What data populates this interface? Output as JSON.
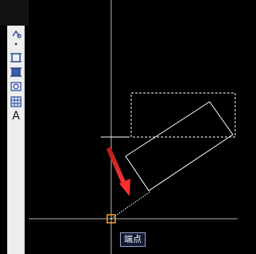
{
  "toolbar": {
    "tools": [
      {
        "icon": "snap-tool-icon"
      },
      {
        "icon": "point-icon"
      },
      {
        "icon": "hatch-icon"
      },
      {
        "icon": "gradient-icon"
      },
      {
        "icon": "region-icon"
      },
      {
        "icon": "table-icon"
      },
      {
        "icon": "text-icon",
        "label": "A"
      }
    ]
  },
  "tooltip": {
    "text": "端点"
  },
  "colors": {
    "canvas_background": "#000000",
    "crosshair": "#e8e8e8",
    "geometry": "#ffffff",
    "arrow": "#e02828",
    "snap_marker": "#ff9a30",
    "tooltip_background": "#0f1732"
  }
}
